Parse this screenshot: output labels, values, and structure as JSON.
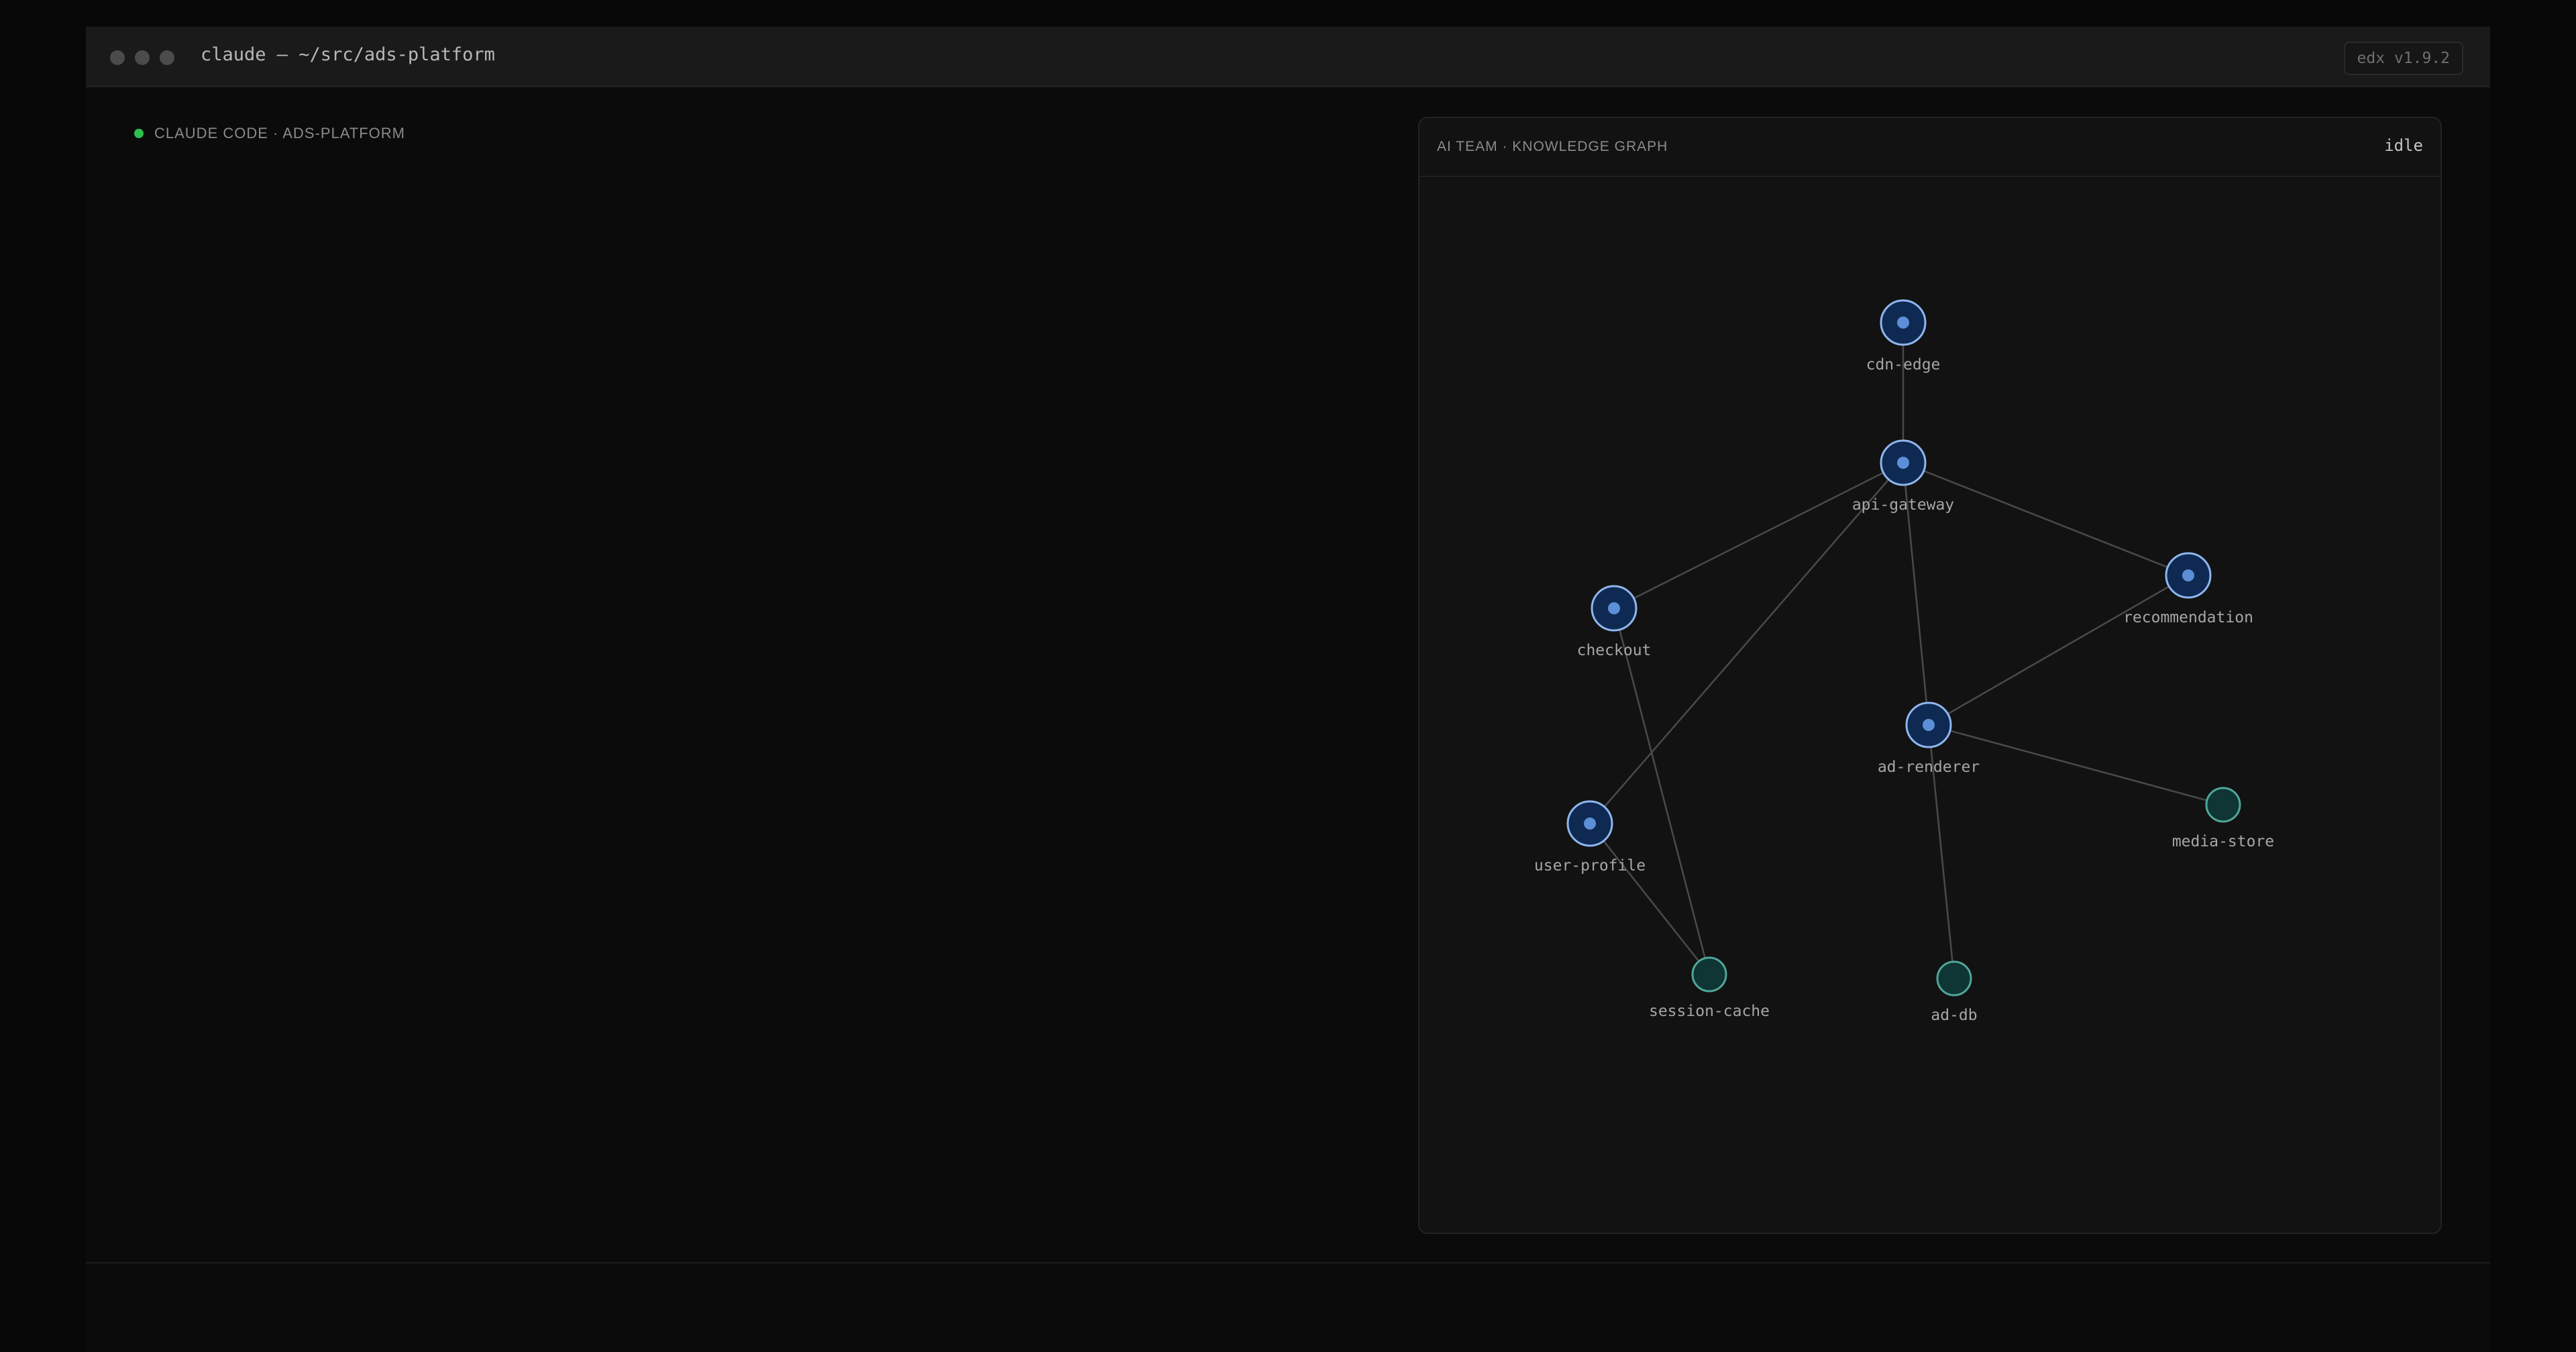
{
  "window": {
    "title": "claude — ~/src/ads-platform",
    "version": "edx v1.9.2"
  },
  "session": {
    "label": "CLAUDE CODE · ADS-PLATFORM",
    "status_color": "#2fbf4f"
  },
  "graph_panel": {
    "title": "AI TEAM · KNOWLEDGE GRAPH",
    "state": "idle",
    "nodes": [
      {
        "id": "cdn-edge",
        "label": "cdn-edge",
        "kind": "service"
      },
      {
        "id": "api-gateway",
        "label": "api-gateway",
        "kind": "service"
      },
      {
        "id": "checkout",
        "label": "checkout",
        "kind": "service"
      },
      {
        "id": "recommendation",
        "label": "recommendation",
        "kind": "service"
      },
      {
        "id": "ad-renderer",
        "label": "ad-renderer",
        "kind": "service"
      },
      {
        "id": "user-profile",
        "label": "user-profile",
        "kind": "service"
      },
      {
        "id": "media-store",
        "label": "media-store",
        "kind": "store"
      },
      {
        "id": "session-cache",
        "label": "session-cache",
        "kind": "store"
      },
      {
        "id": "ad-db",
        "label": "ad-db",
        "kind": "store"
      }
    ],
    "edges": [
      [
        "cdn-edge",
        "api-gateway"
      ],
      [
        "api-gateway",
        "checkout"
      ],
      [
        "api-gateway",
        "recommendation"
      ],
      [
        "api-gateway",
        "ad-renderer"
      ],
      [
        "api-gateway",
        "user-profile"
      ],
      [
        "recommendation",
        "ad-renderer"
      ],
      [
        "ad-renderer",
        "media-store"
      ],
      [
        "ad-renderer",
        "ad-db"
      ],
      [
        "checkout",
        "session-cache"
      ],
      [
        "user-profile",
        "session-cache"
      ]
    ],
    "colors": {
      "service_fill": "#0f2a52",
      "service_stroke": "#8fb6ef",
      "service_core": "#5d8fd8",
      "store_fill": "#0f3534",
      "store_stroke": "#4fa79a",
      "edge": "#4a4a4a"
    }
  }
}
